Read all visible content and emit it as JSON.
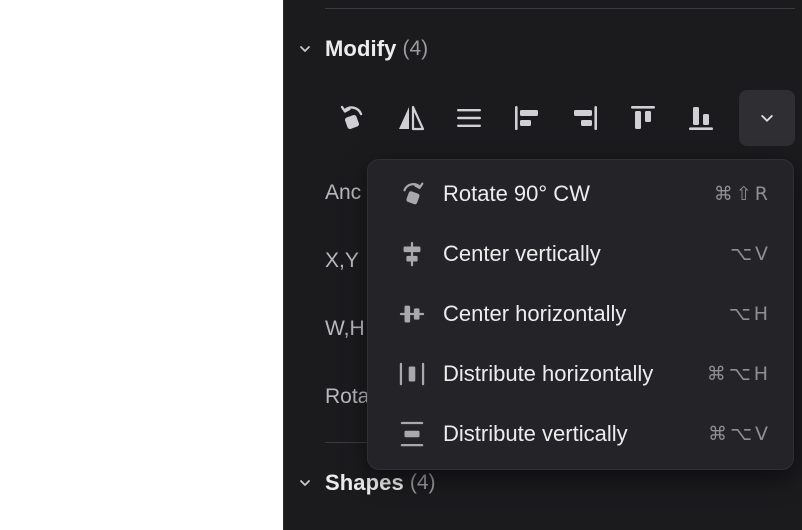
{
  "modify": {
    "title": "Modify",
    "count": "(4)"
  },
  "shapes": {
    "title": "Shapes",
    "count": "(4)"
  },
  "toolbar": {
    "tools": [
      {
        "icon": "rotate-ccw-icon"
      },
      {
        "icon": "flip-horizontal-icon"
      },
      {
        "icon": "align-center-horizontal-icon"
      },
      {
        "icon": "align-left-icon"
      },
      {
        "icon": "align-right-icon"
      },
      {
        "icon": "align-top-icon"
      },
      {
        "icon": "align-bottom-icon"
      },
      {
        "icon": "chevron-down-icon"
      }
    ]
  },
  "properties": {
    "anchor_label": "Anc",
    "xy_label": "X,Y",
    "wh_label": "W,H",
    "rotation_label": "Rota"
  },
  "menu": {
    "items": [
      {
        "label": "Rotate 90° CW",
        "shortcut": "⌘⇧R",
        "icon": "rotate-cw-icon"
      },
      {
        "label": "Center vertically",
        "shortcut": "⌥V",
        "icon": "center-vertically-icon"
      },
      {
        "label": "Center horizontally",
        "shortcut": "⌥H",
        "icon": "center-horizontally-icon"
      },
      {
        "label": "Distribute horizontally",
        "shortcut": "⌘⌥H",
        "icon": "distribute-horizontally-icon"
      },
      {
        "label": "Distribute vertically",
        "shortcut": "⌘⌥V",
        "icon": "distribute-vertically-icon"
      }
    ]
  },
  "colors": {
    "panel_bg": "#1b1b1e",
    "menu_bg": "#242428",
    "text": "#ececec",
    "muted": "#8e8e93"
  }
}
